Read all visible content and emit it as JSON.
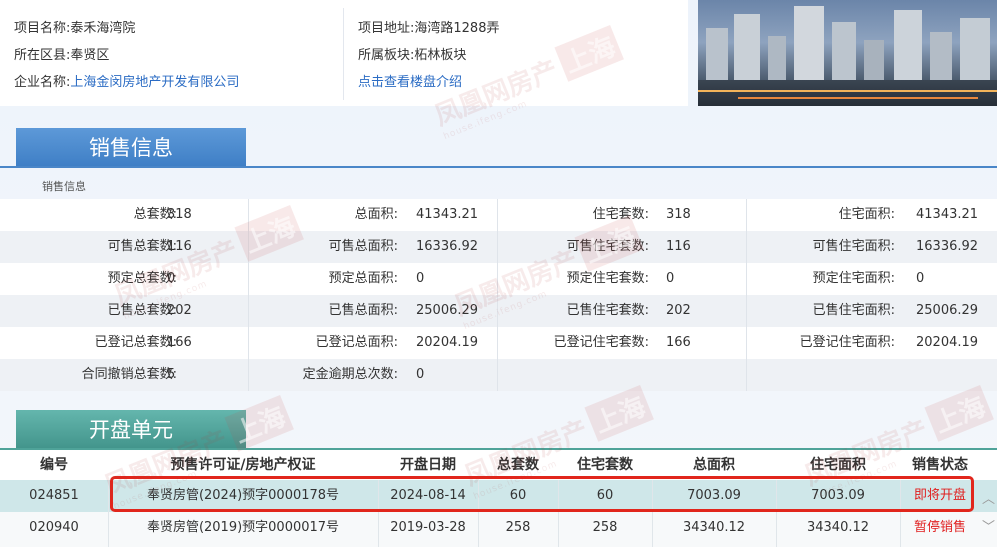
{
  "project": {
    "name_label": "项目名称:",
    "name_value": "泰禾海湾院",
    "district_label": "所在区县:",
    "district_value": "奉贤区",
    "company_label": "企业名称:",
    "company_value": "上海金闵房地产开发有限公司",
    "address_label": "项目地址:",
    "address_value": "海湾路1288弄",
    "block_label": "所属板块:",
    "block_value": "柘林板块",
    "intro_link": "点击查看楼盘介绍"
  },
  "sales": {
    "tab_title": "销售信息",
    "sub_label": "销售信息",
    "rows": [
      [
        [
          "总套数:",
          "318"
        ],
        [
          "总面积:",
          "41343.21"
        ],
        [
          "住宅套数:",
          "318"
        ],
        [
          "住宅面积:",
          "41343.21"
        ]
      ],
      [
        [
          "可售总套数:",
          "116"
        ],
        [
          "可售总面积:",
          "16336.92"
        ],
        [
          "可售住宅套数:",
          "116"
        ],
        [
          "可售住宅面积:",
          "16336.92"
        ]
      ],
      [
        [
          "预定总套数:",
          "0"
        ],
        [
          "预定总面积:",
          "0"
        ],
        [
          "预定住宅套数:",
          "0"
        ],
        [
          "预定住宅面积:",
          "0"
        ]
      ],
      [
        [
          "已售总套数:",
          "202"
        ],
        [
          "已售总面积:",
          "25006.29"
        ],
        [
          "已售住宅套数:",
          "202"
        ],
        [
          "已售住宅面积:",
          "25006.29"
        ]
      ],
      [
        [
          "已登记总套数:",
          "166"
        ],
        [
          "已登记总面积:",
          "20204.19"
        ],
        [
          "已登记住宅套数:",
          "166"
        ],
        [
          "已登记住宅面积:",
          "20204.19"
        ]
      ],
      [
        [
          "合同撤销总套数:",
          "5"
        ],
        [
          "定金逾期总次数:",
          "0"
        ],
        [
          "",
          ""
        ],
        [
          "",
          ""
        ]
      ]
    ]
  },
  "units": {
    "tab_title": "开盘单元",
    "headers": [
      "编号",
      "预售许可证/房地产权证",
      "开盘日期",
      "总套数",
      "住宅套数",
      "总面积",
      "住宅面积",
      "销售状态"
    ],
    "rows": [
      [
        "024851",
        "奉贤房管(2024)预字0000178号",
        "2024-08-14",
        "60",
        "60",
        "7003.09",
        "7003.09",
        "即将开盘"
      ],
      [
        "020940",
        "奉贤房管(2019)预字0000017号",
        "2019-03-28",
        "258",
        "258",
        "34340.12",
        "34340.12",
        "暂停销售"
      ]
    ]
  },
  "watermark": {
    "brand": "凤凰网房产",
    "city": "上海",
    "domain": "house.ifeng.com"
  },
  "colors": {
    "sales_tab": "#4a86c8",
    "units_tab": "#4fa399",
    "link": "#2b6cc4",
    "status_red": "#e02020",
    "highlight_border": "#e1261c"
  }
}
